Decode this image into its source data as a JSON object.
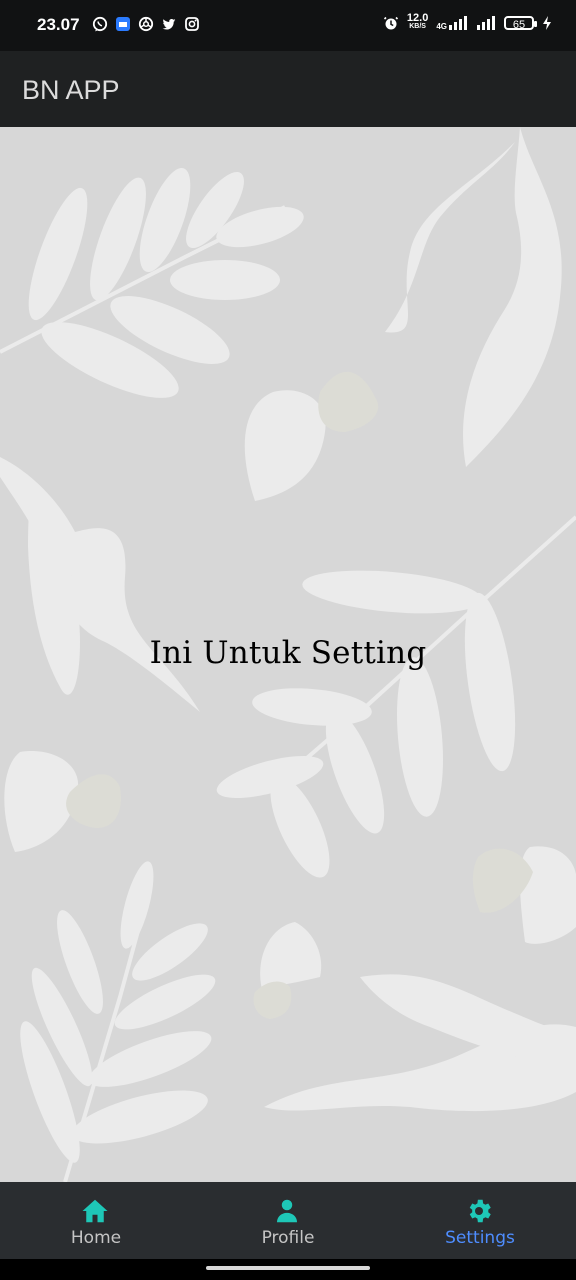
{
  "status_bar": {
    "time": "23.07",
    "left_icons": [
      "whatsapp-icon",
      "messages-icon",
      "chrome-icon",
      "twitter-icon",
      "instagram-icon"
    ],
    "network_speed": "12.0",
    "network_speed_unit": "KB/S",
    "network_type": "4G",
    "battery_level": "65"
  },
  "app_bar": {
    "title": "BN APP"
  },
  "main": {
    "message": "Ini Untuk Setting"
  },
  "bottom_nav": {
    "items": [
      {
        "label": "Home",
        "icon": "home-icon",
        "active": false
      },
      {
        "label": "Profile",
        "icon": "person-icon",
        "active": false
      },
      {
        "label": "Settings",
        "icon": "gear-icon",
        "active": true
      }
    ]
  },
  "colors": {
    "status_bar": "#111213",
    "app_bar": "#1f2122",
    "background": "#d7d7d7",
    "bottom_nav": "#2a2d30",
    "nav_icon": "#1ec7b7",
    "active_label": "#4e8dff"
  }
}
